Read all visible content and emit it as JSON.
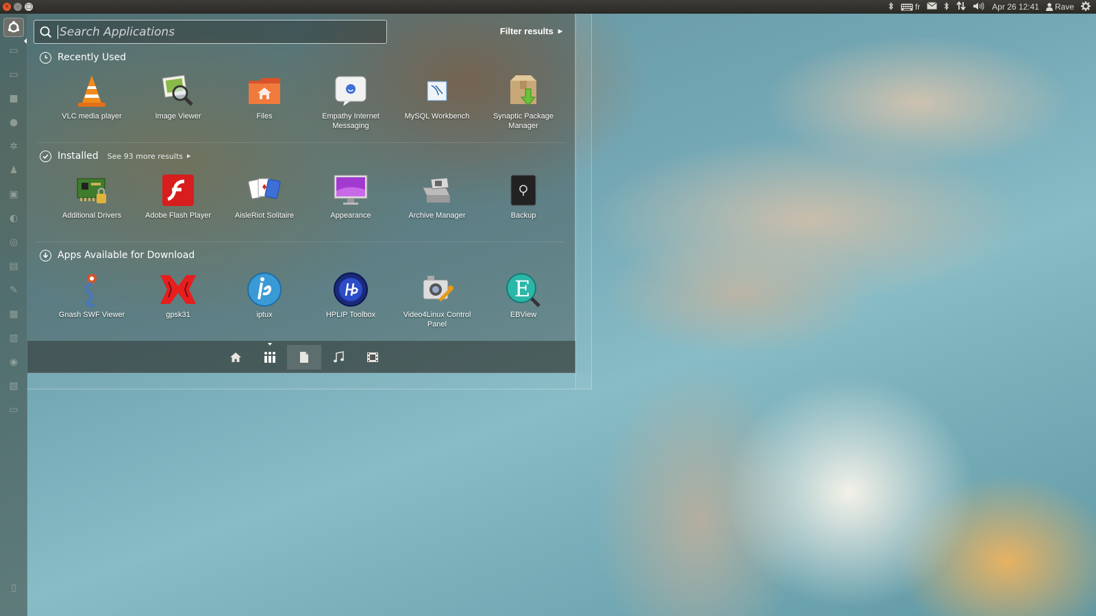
{
  "window_controls": {
    "close": "×",
    "minimize": "–",
    "maximize": "□"
  },
  "panel": {
    "keyboard_layout": "fr",
    "datetime": "Apr 26 12:41",
    "user": "Rave",
    "indicator_icons": [
      "bluetooth-icon",
      "keyboard-icon",
      "mail-icon",
      "bluetooth-icon",
      "network-icon",
      "volume-icon",
      "user-icon",
      "gear-icon"
    ]
  },
  "dash": {
    "search": {
      "placeholder": "Search Applications",
      "value": ""
    },
    "filter_label": "Filter results",
    "sections": {
      "recent": {
        "title": "Recently Used",
        "apps": [
          {
            "name": "VLC media player",
            "icon": "vlc-icon"
          },
          {
            "name": "Image Viewer",
            "icon": "image-viewer-icon"
          },
          {
            "name": "Files",
            "icon": "files-icon"
          },
          {
            "name": "Empathy Internet Messaging",
            "icon": "empathy-icon"
          },
          {
            "name": "MySQL Workbench",
            "icon": "mysql-workbench-icon"
          },
          {
            "name": "Synaptic Package Manager",
            "icon": "synaptic-icon"
          }
        ]
      },
      "installed": {
        "title": "Installed",
        "see_more": "See 93 more results",
        "apps": [
          {
            "name": "Additional Drivers",
            "icon": "additional-drivers-icon"
          },
          {
            "name": "Adobe Flash Player",
            "icon": "flash-player-icon"
          },
          {
            "name": "AisleRiot Solitaire",
            "icon": "solitaire-icon"
          },
          {
            "name": "Appearance",
            "icon": "appearance-icon"
          },
          {
            "name": "Archive Manager",
            "icon": "archive-manager-icon"
          },
          {
            "name": "Backup",
            "icon": "backup-icon"
          }
        ]
      },
      "download": {
        "title": "Apps Available for Download",
        "apps": [
          {
            "name": "Gnash SWF Viewer",
            "icon": "gnash-icon"
          },
          {
            "name": "gpsk31",
            "icon": "gpsk31-icon"
          },
          {
            "name": "iptux",
            "icon": "iptux-icon"
          },
          {
            "name": "HPLIP Toolbox",
            "icon": "hplip-icon"
          },
          {
            "name": "Video4Linux Control Panel",
            "icon": "v4l-control-icon"
          },
          {
            "name": "EBView",
            "icon": "ebview-icon"
          }
        ]
      }
    },
    "lenses": [
      "home-icon",
      "applications-icon",
      "files-icon",
      "music-icon",
      "video-icon"
    ],
    "active_lens": "applications-icon",
    "highlighted_lens": "files-icon"
  },
  "colors": {
    "panel_bg": "#2b2a27",
    "close_button": "#e2572a",
    "text": "#ffffff"
  }
}
